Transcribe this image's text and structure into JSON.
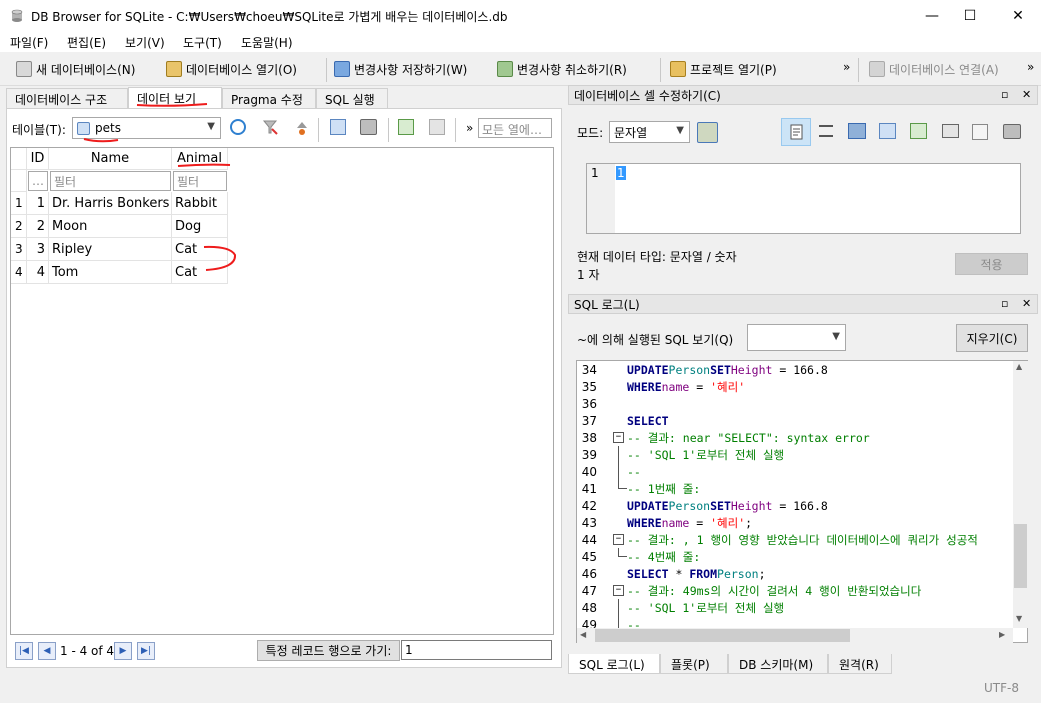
{
  "window": {
    "title": "DB Browser for SQLite - C:₩Users₩choeu₩SQLite로 가볍게 배우는 데이터베이스.db",
    "minimize": "—",
    "maximize": "☐",
    "close": "✕"
  },
  "menu": [
    "파일(F)",
    "편집(E)",
    "보기(V)",
    "도구(T)",
    "도움말(H)"
  ],
  "toolbar": {
    "new_db": "새 데이터베이스(N)",
    "open_db": "데이터베이스 열기(O)",
    "write_changes": "변경사항 저장하기(W)",
    "revert_changes": "변경사항 취소하기(R)",
    "open_project": "프로젝트 열기(P)",
    "attach_db": "데이터베이스 연결(A)",
    "overflow": "»"
  },
  "main_tabs": [
    "데이터베이스 구조",
    "데이터 보기",
    "Pragma 수정",
    "SQL 실행"
  ],
  "browse": {
    "table_label": "테이블(T):",
    "table_value": "pets",
    "overflow": "»",
    "filter_all_placeholder": "모든 열에…",
    "columns": [
      "ID",
      "Name",
      "Animal"
    ],
    "filter_more": "…",
    "filter_placeholder": "필터",
    "rows": [
      {
        "num": "1",
        "id": "1",
        "name": "Dr. Harris Bonkers",
        "animal": "Rabbit"
      },
      {
        "num": "2",
        "id": "2",
        "name": "Moon",
        "animal": "Dog"
      },
      {
        "num": "3",
        "id": "3",
        "name": "Ripley",
        "animal": "Cat"
      },
      {
        "num": "4",
        "id": "4",
        "name": "Tom",
        "animal": "Cat"
      }
    ],
    "record_range": "1 - 4 of 4",
    "goto_label": "특정 레코드 행으로 가기:",
    "goto_value": "1"
  },
  "edit_cell": {
    "title": "데이터베이스 셀 수정하기(C)",
    "mode_label": "모드:",
    "mode_value": "문자열",
    "line_number": "1",
    "cell_value": "1",
    "type_info": "현재 데이터 타입: 문자열 / 숫자",
    "size_info": "1 자",
    "apply": "적용"
  },
  "sql_log": {
    "title": "SQL 로그(L)",
    "submitted_by_label": "~에 의해 실행된 SQL 보기(Q)",
    "clear": "지우기(C)"
  },
  "bottom_tabs": [
    "SQL 로그(L)",
    "플롯(P)",
    "DB 스키마(M)",
    "원격(R)"
  ],
  "status": {
    "encoding": "UTF-8"
  },
  "dock_buttons": {
    "float": "▫",
    "close": "✕"
  }
}
